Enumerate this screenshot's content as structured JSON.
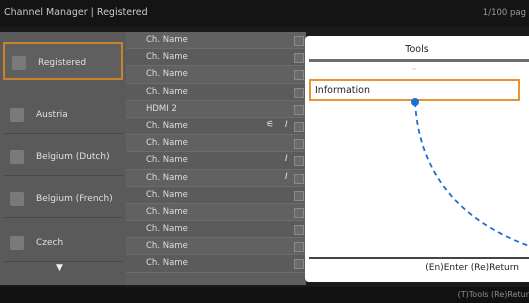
{
  "header": {
    "title": "Channel Manager | Registered",
    "page_indicator": "1/100 pag"
  },
  "sidebar": {
    "items": [
      {
        "label": "Registered",
        "selected": true
      },
      {
        "label": "Austria"
      },
      {
        "label": "Belgium (Dutch)"
      },
      {
        "label": "Belgium (French)"
      },
      {
        "label": "Czech"
      }
    ],
    "scroll_down_glyph": "▼"
  },
  "channels": [
    {
      "name": "Ch. Name",
      "icon_a": "",
      "icon_b": ""
    },
    {
      "name": "Ch. Name",
      "icon_a": "",
      "icon_b": ""
    },
    {
      "name": "Ch. Name",
      "icon_a": "",
      "icon_b": ""
    },
    {
      "name": "Ch. Name",
      "icon_a": "",
      "icon_b": ""
    },
    {
      "name": "HDMI 2",
      "icon_a": "",
      "icon_b": ""
    },
    {
      "name": "Ch. Name",
      "icon_a": "⚟",
      "icon_b": "𝐼"
    },
    {
      "name": "Ch. Name",
      "icon_a": "",
      "icon_b": ""
    },
    {
      "name": "Ch. Name",
      "icon_a": "",
      "icon_b": "𝐼"
    },
    {
      "name": "Ch. Name",
      "icon_a": "",
      "icon_b": "𝐼"
    },
    {
      "name": "Ch. Name",
      "icon_a": "",
      "icon_b": ""
    },
    {
      "name": "Ch. Name",
      "icon_a": "",
      "icon_b": ""
    },
    {
      "name": "Ch. Name",
      "icon_a": "",
      "icon_b": ""
    },
    {
      "name": "Ch. Name",
      "icon_a": "",
      "icon_b": ""
    },
    {
      "name": "Ch. Name",
      "icon_a": "",
      "icon_b": ""
    }
  ],
  "tools_popup": {
    "title": "Tools",
    "items": [
      "Information"
    ],
    "footer": "(En)Enter  (Re)Return"
  },
  "footer_hint": "(T)Tools  (Re)Retur",
  "colors": {
    "focus": "#e8952f",
    "arrow": "#1f6fd1"
  }
}
